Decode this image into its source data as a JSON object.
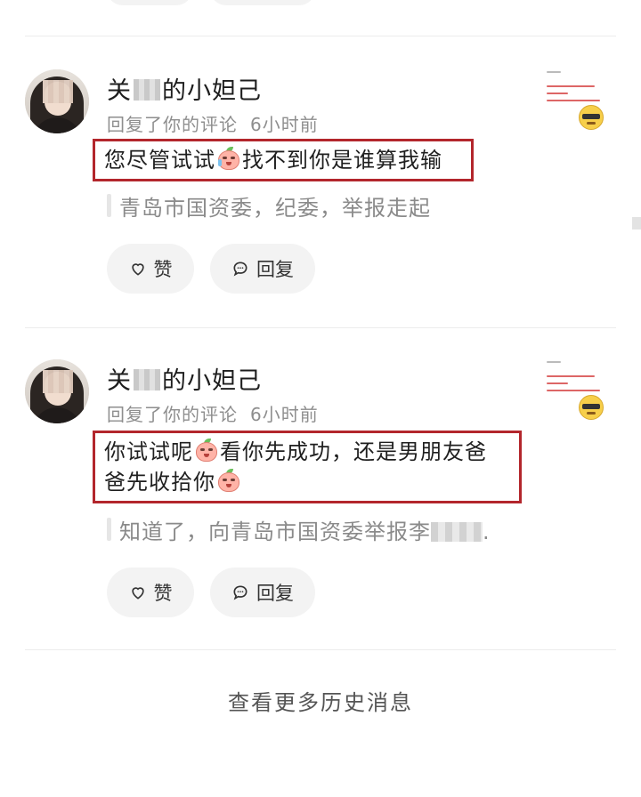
{
  "messages": [
    {
      "name_prefix": "关",
      "name_suffix": "的小妲己",
      "action": "回复了你的评论",
      "time": "6小时前",
      "content_line1_a": "您尽管试试",
      "content_line1_b": "找不到你是谁算我输",
      "content_line2_a": "",
      "quote_text": "青岛市国资委，纪委，举报走起",
      "quote_suffix": "",
      "like_label": "赞",
      "reply_label": "回复"
    },
    {
      "name_prefix": "关",
      "name_suffix": "的小妲己",
      "action": "回复了你的评论",
      "time": "6小时前",
      "content_line1_a": "你试试呢",
      "content_line1_b": "看你先成功，还是男朋友爸",
      "content_line2_a": "爸先收拾你",
      "quote_text": "知道了，向青岛市国资委举报李",
      "quote_suffix": ".",
      "like_label": "赞",
      "reply_label": "回复"
    }
  ],
  "footer": {
    "more_label": "查看更多历史消息"
  },
  "colors": {
    "highlight_border": "#b3262c",
    "pill_bg": "#f3f3f3",
    "meta_text": "#8e8e8e"
  },
  "icons": {
    "like": "heart-icon",
    "reply": "chat-bubble-icon",
    "emoji_cry": "crying-peach-emoji-icon",
    "emoji_pout": "pouting-peach-emoji-icon",
    "sunglasses": "sunglasses-smiley-icon"
  }
}
